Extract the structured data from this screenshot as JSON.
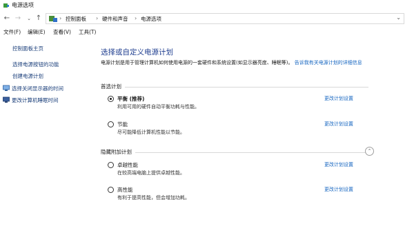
{
  "window": {
    "title": "电源选项"
  },
  "address_bar": {
    "crumbs": [
      "控制面板",
      "硬件和声音",
      "电源选项"
    ]
  },
  "menu": [
    "文件(F)",
    "编辑(E)",
    "查看(V)",
    "工具(T)"
  ],
  "sidebar": {
    "home": "控制面板主页",
    "links": [
      "选择电源按钮的功能",
      "创建电源计划"
    ],
    "icon_links": [
      "选择关闭显示器的时间",
      "更改计算机睡眠时间"
    ]
  },
  "main": {
    "title": "选择或自定义电源计划",
    "desc_text": "电源计划是用于管理计算机如何使用电源的一套硬件和系统设置(如显示器亮度、睡眠等)。",
    "desc_link": "告诉我有关电源计划的详细信息",
    "preferred_section": "首选计划",
    "hidden_section": "隐藏附加计划",
    "change_label": "更改计划设置",
    "preferred_plans": [
      {
        "name": "平衡 (推荐)",
        "desc": "利用可用的硬件自动平衡功耗与性能。",
        "selected": true
      },
      {
        "name": "节能",
        "desc": "尽可能降低计算机性能以节能。",
        "selected": false
      }
    ],
    "hidden_plans": [
      {
        "name": "卓越性能",
        "desc": "在较高端电脑上提供卓越性能。",
        "selected": false
      },
      {
        "name": "高性能",
        "desc": "有利于提高性能，但会增加功耗。",
        "selected": false
      }
    ]
  }
}
